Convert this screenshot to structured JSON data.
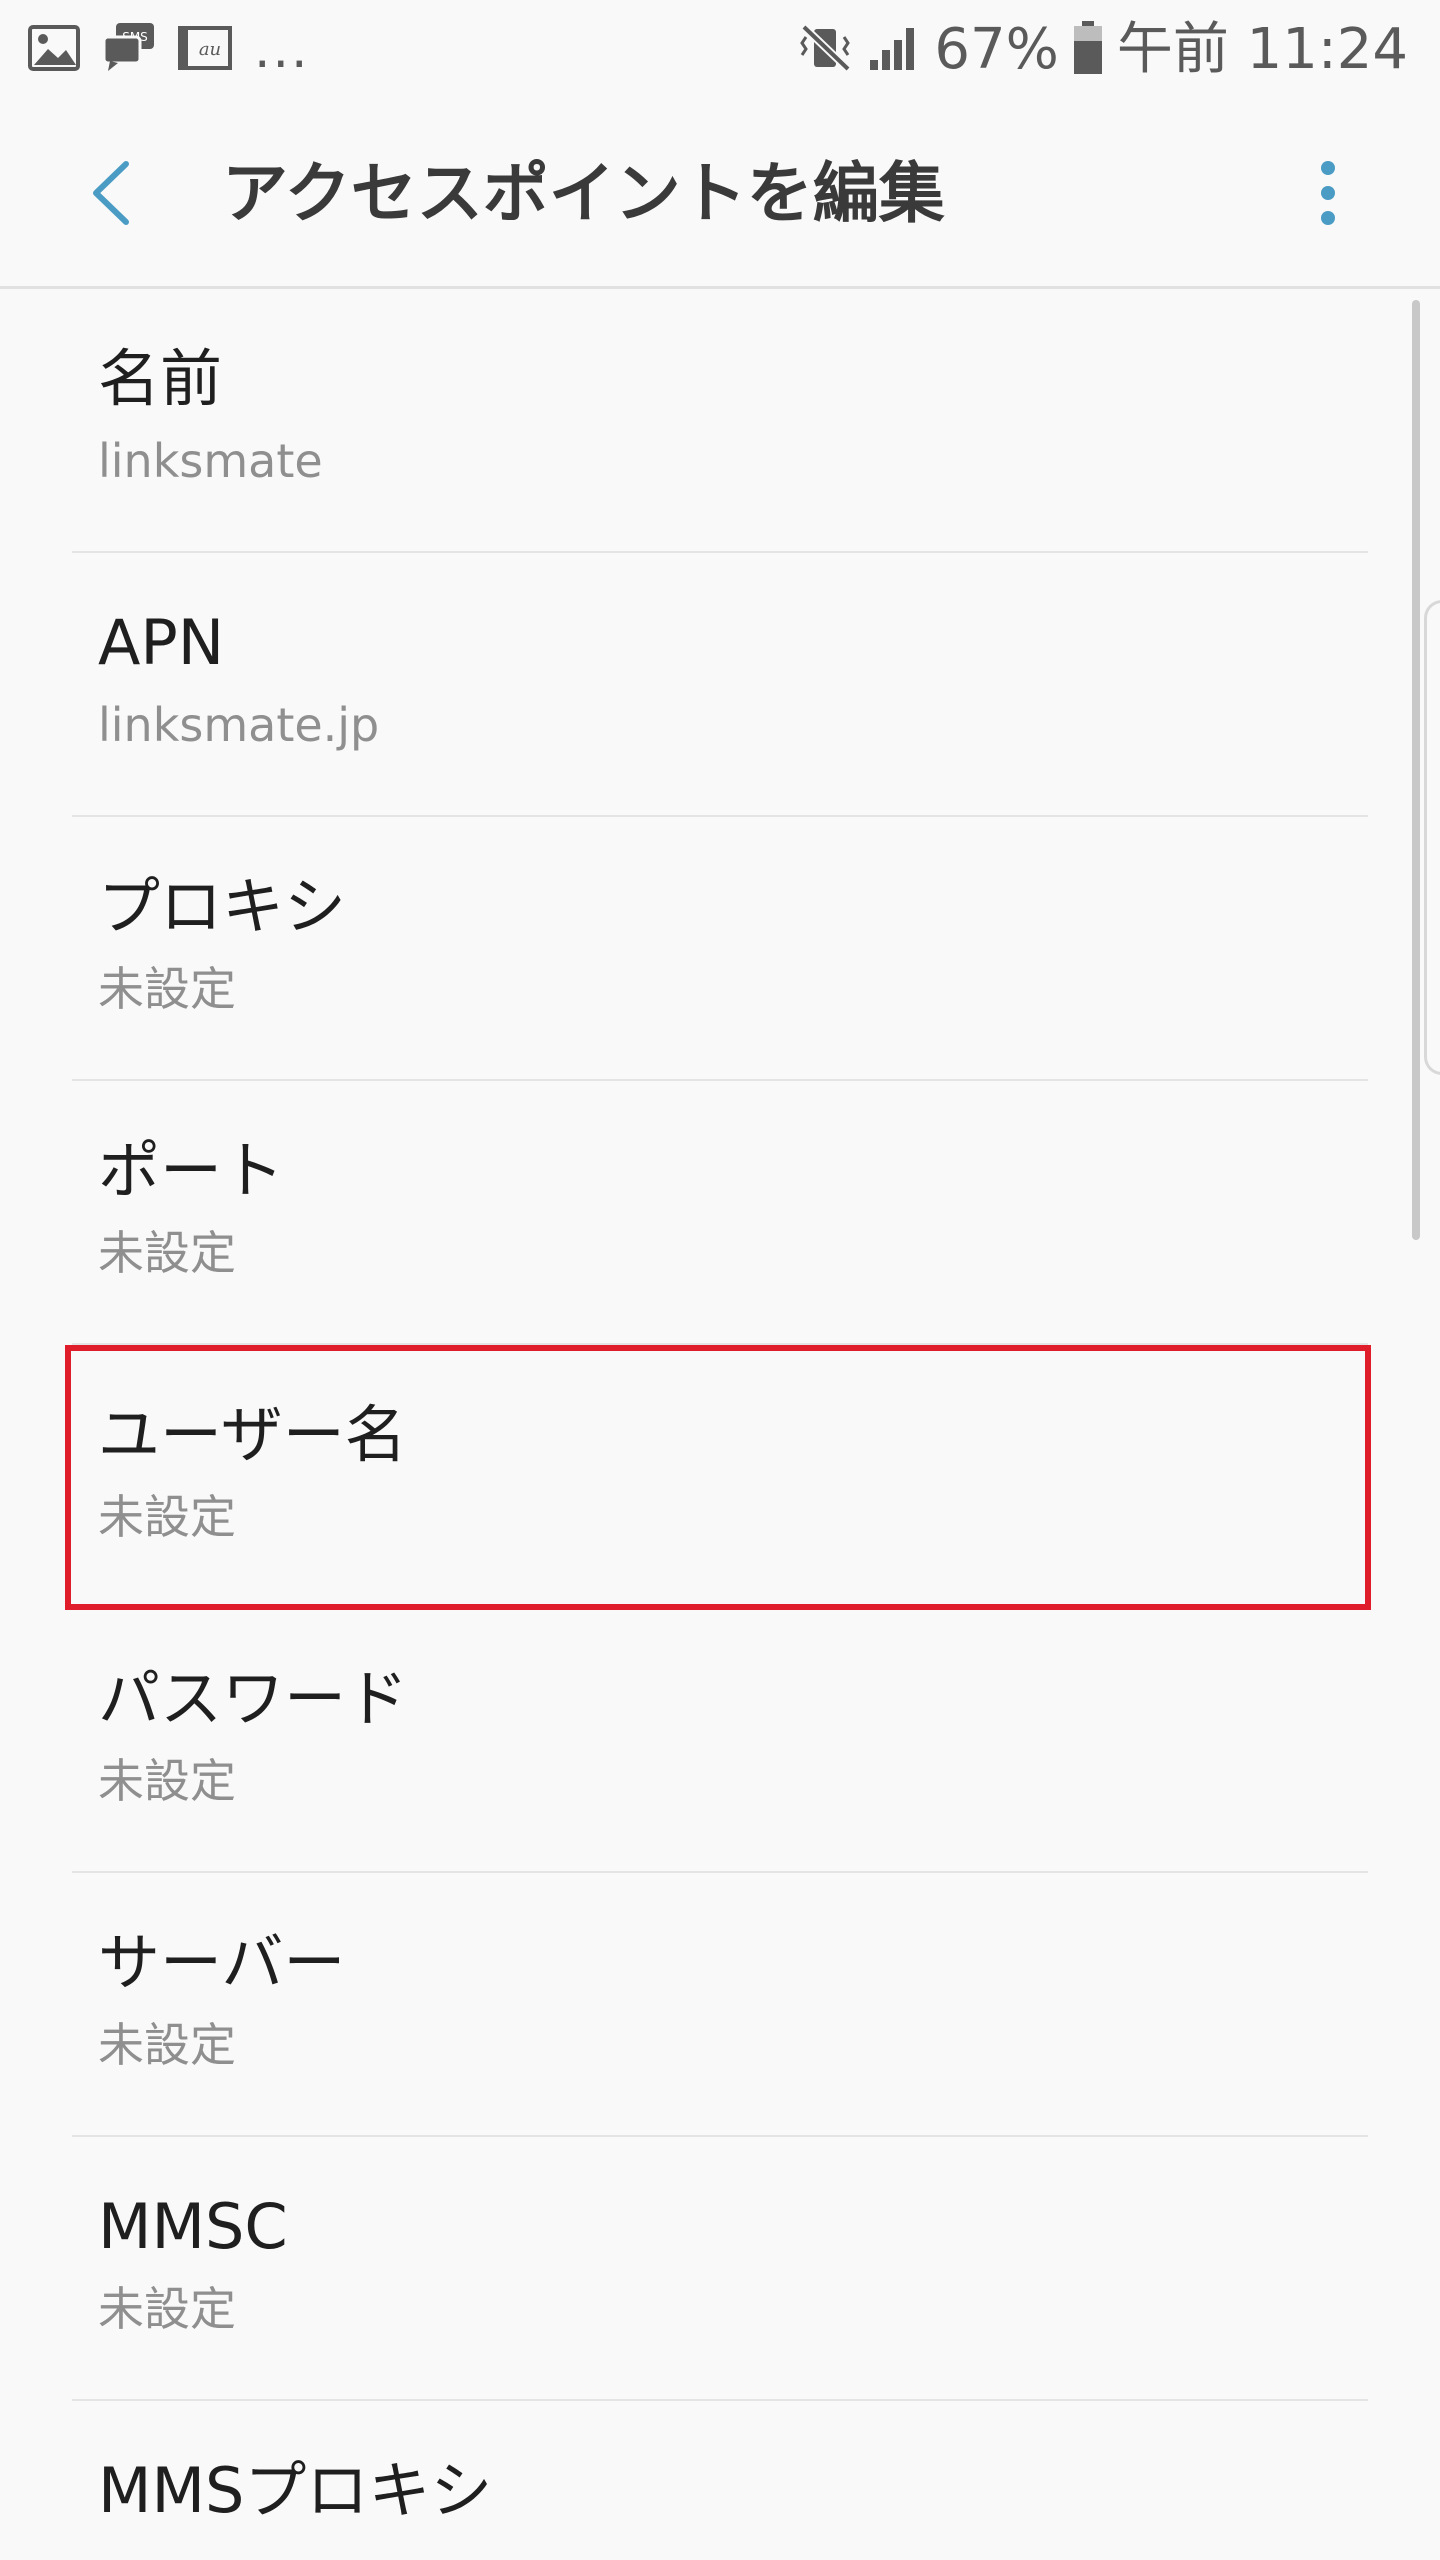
{
  "status_bar": {
    "notifications": [
      {
        "icon": "gallery-icon"
      },
      {
        "icon": "sms-icon",
        "label": "SMS"
      },
      {
        "icon": "au-icon",
        "label": "au"
      }
    ],
    "more": "...",
    "battery_percent": "67%",
    "time": "午前 11:24",
    "icons": [
      "vibrate-mute-icon",
      "signal-icon",
      "battery-icon"
    ]
  },
  "app_bar": {
    "back_icon": "chevron-left-icon",
    "title": "アクセスポイントを編集",
    "more_icon": "more-vert-icon",
    "accent_color": "#4a9cc4"
  },
  "items": [
    {
      "title": "名前",
      "value": "linksmate"
    },
    {
      "title": "APN",
      "value": "linksmate.jp"
    },
    {
      "title": "プロキシ",
      "value": "未設定"
    },
    {
      "title": "ポート",
      "value": "未設定"
    },
    {
      "title": "ユーザー名",
      "value": "未設定"
    },
    {
      "title": "パスワード",
      "value": "未設定"
    },
    {
      "title": "サーバー",
      "value": "未設定"
    },
    {
      "title": "MMSC",
      "value": "未設定"
    },
    {
      "title": "MMSプロキシ",
      "value": ""
    }
  ],
  "highlight_color": "#e01e2b"
}
